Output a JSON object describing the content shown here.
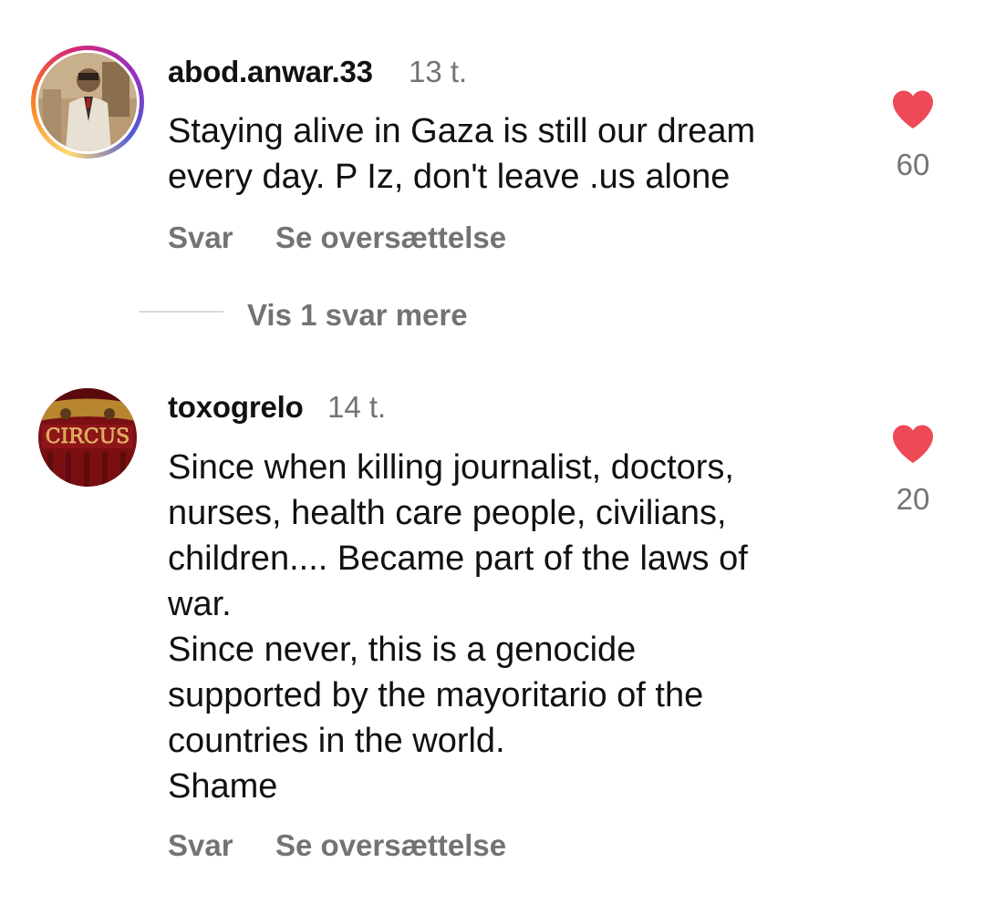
{
  "comments": [
    {
      "username": "abod.anwar.33",
      "time": "13 t.",
      "text": "Staying alive in Gaza is still our dream\nevery day. P Iz, don't leave .us alone",
      "likes": "60",
      "reply_label": "Svar",
      "translate_label": "Se oversættelse",
      "has_story_ring": true
    },
    {
      "username": "toxogrelo",
      "time": "14 t.",
      "text": "Since when killing journalist, doctors,\nnurses, health care people, civilians,\nchildren.... Became part of the laws of\nwar.\nSince never, this is a genocide\nsupported by the mayoritario of the\ncountries in the world.\nShame",
      "likes": "20",
      "reply_label": "Svar",
      "translate_label": "Se oversættelse",
      "has_story_ring": false
    }
  ],
  "replies": {
    "view_more_label": "Vis 1 svar mere"
  },
  "icons": {
    "like": "heart-icon",
    "avatar": "avatar"
  },
  "colors": {
    "heart": "#ed4956",
    "secondary_text": "#737373"
  }
}
